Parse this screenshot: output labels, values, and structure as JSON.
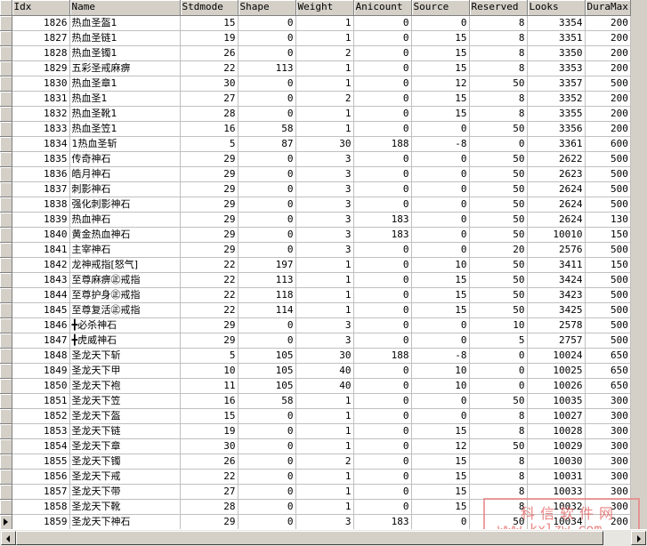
{
  "grid": {
    "columns": [
      "Idx",
      "Name",
      "Stdmode",
      "Shape",
      "Weight",
      "Anicount",
      "Source",
      "Reserved",
      "Looks",
      "DuraMax"
    ],
    "rows": [
      [
        "1826",
        "热血圣盔1",
        "15",
        "0",
        "1",
        "0",
        "0",
        "8",
        "3354",
        "200"
      ],
      [
        "1827",
        "热血圣链1",
        "19",
        "0",
        "1",
        "0",
        "15",
        "8",
        "3351",
        "200"
      ],
      [
        "1828",
        "热血圣镯1",
        "26",
        "0",
        "2",
        "0",
        "15",
        "8",
        "3350",
        "200"
      ],
      [
        "1829",
        "五彩圣戒麻痹",
        "22",
        "113",
        "1",
        "0",
        "15",
        "8",
        "3353",
        "200"
      ],
      [
        "1830",
        "热血圣章1",
        "30",
        "0",
        "1",
        "0",
        "12",
        "50",
        "3357",
        "500"
      ],
      [
        "1831",
        "热血圣1",
        "27",
        "0",
        "2",
        "0",
        "15",
        "8",
        "3352",
        "200"
      ],
      [
        "1832",
        "热血圣靴1",
        "28",
        "0",
        "1",
        "0",
        "15",
        "8",
        "3355",
        "200"
      ],
      [
        "1833",
        "热血圣笠1",
        "16",
        "58",
        "1",
        "0",
        "0",
        "50",
        "3356",
        "200"
      ],
      [
        "1834",
        "1热血圣斩",
        "5",
        "87",
        "30",
        "188",
        "-8",
        "0",
        "3361",
        "600"
      ],
      [
        "1835",
        "传奇神石",
        "29",
        "0",
        "3",
        "0",
        "0",
        "50",
        "2622",
        "500"
      ],
      [
        "1836",
        "皓月神石",
        "29",
        "0",
        "3",
        "0",
        "0",
        "50",
        "2623",
        "500"
      ],
      [
        "1837",
        "刺影神石",
        "29",
        "0",
        "3",
        "0",
        "0",
        "50",
        "2624",
        "500"
      ],
      [
        "1838",
        "强化刺影神石",
        "29",
        "0",
        "3",
        "0",
        "0",
        "50",
        "2624",
        "500"
      ],
      [
        "1839",
        "热血神石",
        "29",
        "0",
        "3",
        "183",
        "0",
        "50",
        "2624",
        "130"
      ],
      [
        "1840",
        "黄金热血神石",
        "29",
        "0",
        "3",
        "183",
        "0",
        "50",
        "10010",
        "150"
      ],
      [
        "1841",
        "主宰神石",
        "29",
        "0",
        "3",
        "0",
        "0",
        "20",
        "2576",
        "500"
      ],
      [
        "1842",
        "龙神戒指[怒气]",
        "22",
        "197",
        "1",
        "0",
        "10",
        "50",
        "3411",
        "150"
      ],
      [
        "1843",
        "至尊麻痹㊣戒指",
        "22",
        "113",
        "1",
        "0",
        "15",
        "50",
        "3424",
        "500"
      ],
      [
        "1844",
        "至尊护身㊣戒指",
        "22",
        "118",
        "1",
        "0",
        "15",
        "50",
        "3423",
        "500"
      ],
      [
        "1845",
        "至尊复活㊣戒指",
        "22",
        "114",
        "1",
        "0",
        "15",
        "50",
        "3425",
        "500"
      ],
      [
        "1846",
        "╋必杀神石",
        "29",
        "0",
        "3",
        "0",
        "0",
        "10",
        "2578",
        "500"
      ],
      [
        "1847",
        "╋虎威神石",
        "29",
        "0",
        "3",
        "0",
        "0",
        "5",
        "2757",
        "500"
      ],
      [
        "1848",
        "圣龙天下斩",
        "5",
        "105",
        "30",
        "188",
        "-8",
        "0",
        "10024",
        "650"
      ],
      [
        "1849",
        "圣龙天下甲",
        "10",
        "105",
        "40",
        "0",
        "10",
        "0",
        "10025",
        "650"
      ],
      [
        "1850",
        "圣龙天下袍",
        "11",
        "105",
        "40",
        "0",
        "10",
        "0",
        "10026",
        "650"
      ],
      [
        "1851",
        "圣龙天下笠",
        "16",
        "58",
        "1",
        "0",
        "0",
        "50",
        "10035",
        "300"
      ],
      [
        "1852",
        "圣龙天下盔",
        "15",
        "0",
        "1",
        "0",
        "0",
        "8",
        "10027",
        "300"
      ],
      [
        "1853",
        "圣龙天下链",
        "19",
        "0",
        "1",
        "0",
        "15",
        "8",
        "10028",
        "300"
      ],
      [
        "1854",
        "圣龙天下章",
        "30",
        "0",
        "1",
        "0",
        "12",
        "50",
        "10029",
        "300"
      ],
      [
        "1855",
        "圣龙天下镯",
        "26",
        "0",
        "2",
        "0",
        "15",
        "8",
        "10030",
        "300"
      ],
      [
        "1856",
        "圣龙天下戒",
        "22",
        "0",
        "1",
        "0",
        "15",
        "8",
        "10031",
        "300"
      ],
      [
        "1857",
        "圣龙天下带",
        "27",
        "0",
        "1",
        "0",
        "15",
        "8",
        "10033",
        "300"
      ],
      [
        "1858",
        "圣龙天下靴",
        "28",
        "0",
        "1",
        "0",
        "15",
        "8",
        "10032",
        "300"
      ],
      [
        "1859",
        "圣龙天下神石",
        "29",
        "0",
        "3",
        "183",
        "0",
        "50",
        "10034",
        "200"
      ]
    ]
  },
  "watermark": {
    "top": "科信软件网",
    "bottom": "www.kxlzw.com"
  }
}
